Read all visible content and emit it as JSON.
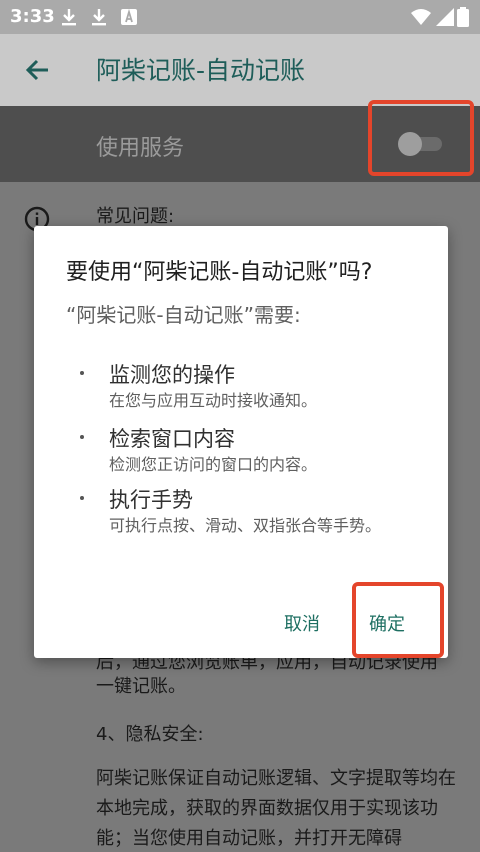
{
  "status_bar": {
    "time": "3:33",
    "left_icons": [
      "download-icon",
      "download-icon",
      "keyboard-icon"
    ],
    "right_icons": [
      "wifi-icon",
      "signal-icon",
      "battery-icon"
    ]
  },
  "app_bar": {
    "back_icon": "arrow-left-icon",
    "title": "阿柴记账-自动记账"
  },
  "service": {
    "label": "使用服务",
    "toggle_on": false
  },
  "background": {
    "faq_heading": "常见问题:",
    "partial_line_1": "后，通过您浏览账单，应用，自动记录使用",
    "partial_line_2": "一键记账。",
    "privacy_heading": "4、隐私安全:",
    "privacy_paragraph": "阿柴记账保证自动记账逻辑、文字提取等均在本地完成，获取的界面数据仅用于实现该功能；当您使用自动记账，并打开无障碍"
  },
  "dialog": {
    "title": "要使用“阿柴记账-自动记账”吗?",
    "subtitle": "“阿柴记账-自动记账”需要:",
    "permissions": [
      {
        "title": "监测您的操作",
        "desc": "在您与应用互动时接收通知。"
      },
      {
        "title": "检索窗口内容",
        "desc": "检测您正访问的窗口的内容。"
      },
      {
        "title": "执行手势",
        "desc": "可执行点按、滑动、双指张合等手势。"
      }
    ],
    "cancel_label": "取消",
    "ok_label": "确定"
  },
  "colors": {
    "accent": "#1e6f62",
    "highlight": "#e4452b",
    "overlay": "#7a7a7a"
  }
}
